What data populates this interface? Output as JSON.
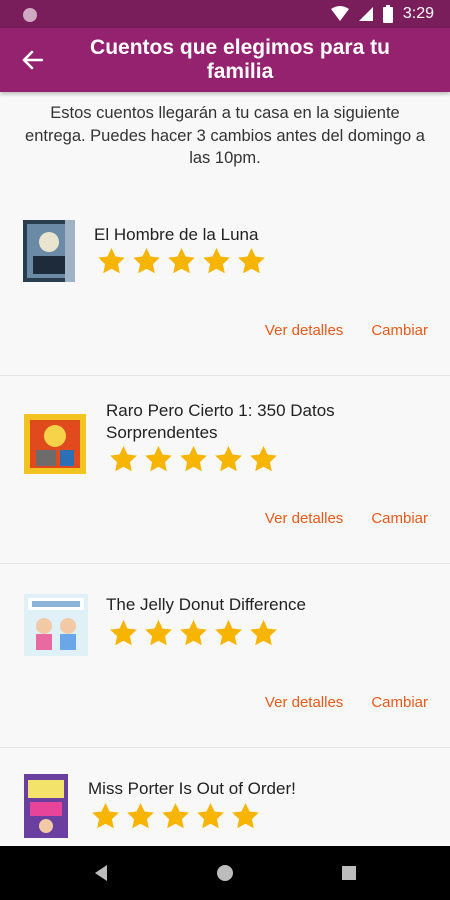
{
  "status_bar": {
    "time": "3:29"
  },
  "app_bar": {
    "title": "Cuentos que elegimos para tu familia"
  },
  "intro_text": "Estos cuentos llegarán a tu casa en la siguiente entrega. Puedes hacer 3 cambios antes del domingo a las 10pm.",
  "books": [
    {
      "title": "El Hombre de la Luna",
      "rating": 5,
      "details_label": "Ver detalles",
      "change_label": "Cambiar"
    },
    {
      "title": "Raro Pero Cierto 1: 350 Datos Sorprendentes",
      "rating": 5,
      "details_label": "Ver detalles",
      "change_label": "Cambiar"
    },
    {
      "title": "The Jelly Donut Difference",
      "rating": 5,
      "details_label": "Ver detalles",
      "change_label": "Cambiar"
    },
    {
      "title": "Miss Porter Is Out of Order!",
      "rating": 5
    }
  ],
  "colors": {
    "status_bar": "#7a1d5b",
    "app_bar": "#95226e",
    "accent": "#e8591c",
    "star": "#f7b500"
  }
}
